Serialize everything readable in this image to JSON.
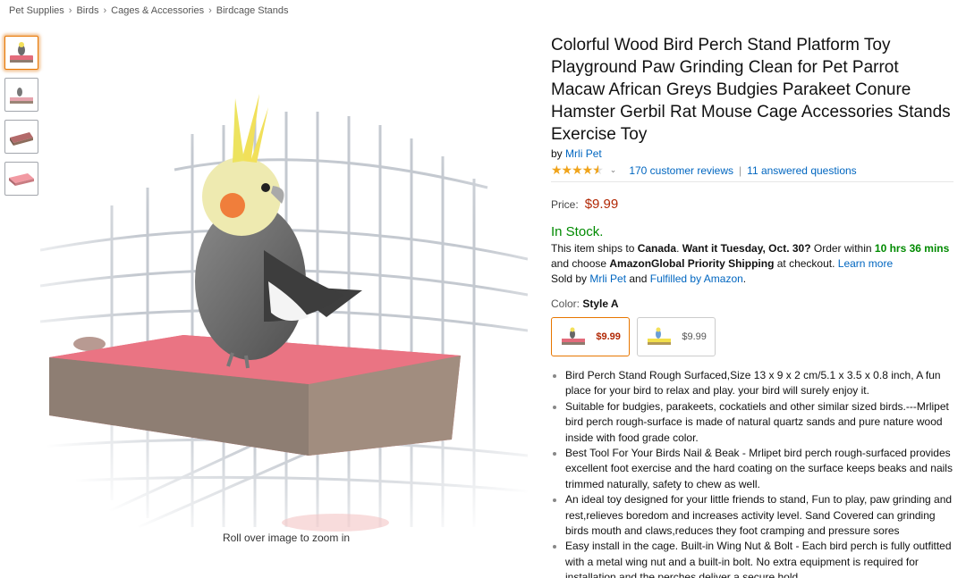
{
  "breadcrumb": [
    "Pet Supplies",
    "Birds",
    "Cages & Accessories",
    "Birdcage Stands"
  ],
  "gallery": {
    "zoom_hint": "Roll over image to zoom in"
  },
  "product": {
    "title": "Colorful Wood Bird Perch Stand Platform Toy Playground Paw Grinding Clean for Pet Parrot Macaw African Greys Budgies Parakeet Conure Hamster Gerbil Rat Mouse Cage Accessories Stands Exercise Toy",
    "by_label": "by",
    "brand": "Mrli Pet",
    "rating": 4.5,
    "reviews": "170 customer reviews",
    "questions": "11 answered questions",
    "price_label": "Price:",
    "price": "$9.99",
    "stock": "In Stock.",
    "ship": {
      "t1": "This item ships to ",
      "country": "Canada",
      "t2": ". ",
      "want": "Want it Tuesday, Oct. 30?",
      "t3": " Order within ",
      "time": "10 hrs 36 mins",
      "t4": " and choose ",
      "method": "AmazonGlobal Priority Shipping",
      "t5": " at checkout. ",
      "learn": "Learn more",
      "sold_by": "Sold by ",
      "seller": "Mrli Pet",
      "and": " and ",
      "fulfilled": "Fulfilled by Amazon",
      "end": "."
    },
    "color_label": "Color:",
    "color_value": "Style A",
    "swatches": [
      {
        "price": "$9.99"
      },
      {
        "price": "$9.99"
      }
    ],
    "bullets": [
      "Bird Perch Stand Rough Surfaced,Size 13 x 9 x 2 cm/5.1 x 3.5 x 0.8 inch, A fun place for your bird to relax and play. your bird will surely enjoy it.",
      "Suitable for budgies, parakeets, cockatiels and other similar sized birds.---Mrlipet bird perch rough-surface is made of natural quartz sands and pure nature wood inside with food grade color.",
      "Best Tool For Your Birds Nail & Beak - Mrlipet bird perch rough-surfaced provides excellent foot exercise and the hard coating on the surface keeps beaks and nails trimmed naturally, safety to chew as well.",
      "An ideal toy designed for your little friends to stand, Fun to play, paw grinding and rest,relieves boredom and increases activity level. Sand Covered can grinding birds mouth and claws,reduces they foot cramping and pressure sores",
      "Easy install in the cage. Built-in Wing Nut & Bolt - Each bird perch is fully outfitted with a metal wing nut and a built-in bolt. No extra equipment is required for installation and the perches deliver a secure hold."
    ]
  }
}
